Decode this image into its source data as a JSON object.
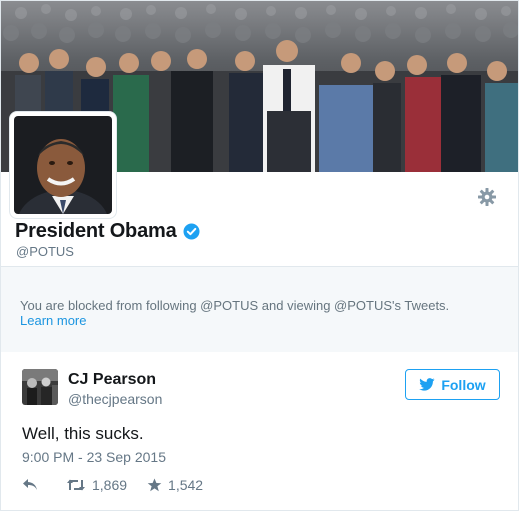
{
  "profile": {
    "display_name": "President Obama",
    "handle": "@POTUS",
    "verified": true
  },
  "blocked_notice": {
    "message": "You are blocked from following @POTUS and viewing @POTUS's Tweets.",
    "link_label": "Learn more"
  },
  "tweet": {
    "author_name": "CJ Pearson",
    "author_handle": "@thecjpearson",
    "follow_label": "Follow",
    "text": "Well, this sucks.",
    "timestamp": "9:00 PM - 23 Sep 2015",
    "retweets": "1,869",
    "likes": "1,542"
  },
  "colors": {
    "accent": "#1da1f2",
    "link": "#1b95e0",
    "muted_text": "#657786",
    "panel_bg": "#f5f8fa"
  },
  "icons": {
    "settings": "gear-icon",
    "verified": "verified-badge-icon",
    "follow": "twitter-bird-icon",
    "reply": "reply-icon",
    "retweet": "retweet-icon",
    "like": "star-icon"
  }
}
